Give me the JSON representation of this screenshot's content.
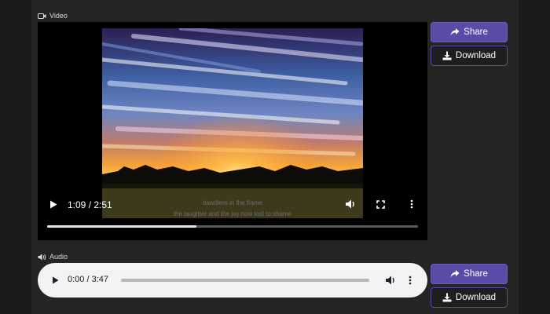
{
  "video_section": {
    "label": "Video",
    "icon": "video-camera-icon",
    "player": {
      "time": "1:09 / 2:51",
      "progress_fraction": 0.403,
      "subtitle_line1": "dawdlers in the frame",
      "subtitle_line2": "the laughter and the joy now lost to shame",
      "icons": [
        "play-icon",
        "volume-icon",
        "fullscreen-icon",
        "more-options-icon"
      ]
    },
    "share_label": "Share",
    "download_label": "Download"
  },
  "audio_section": {
    "label": "Audio",
    "icon": "speaker-icon",
    "player": {
      "time": "0:00 / 3:47",
      "progress_fraction": 0.0,
      "icons": [
        "play-icon",
        "volume-icon",
        "more-options-icon"
      ]
    },
    "share_label": "Share",
    "download_label": "Download"
  },
  "colors": {
    "accent": "#5b4aa6",
    "background": "#1b1b1b",
    "panel": "#242424"
  }
}
